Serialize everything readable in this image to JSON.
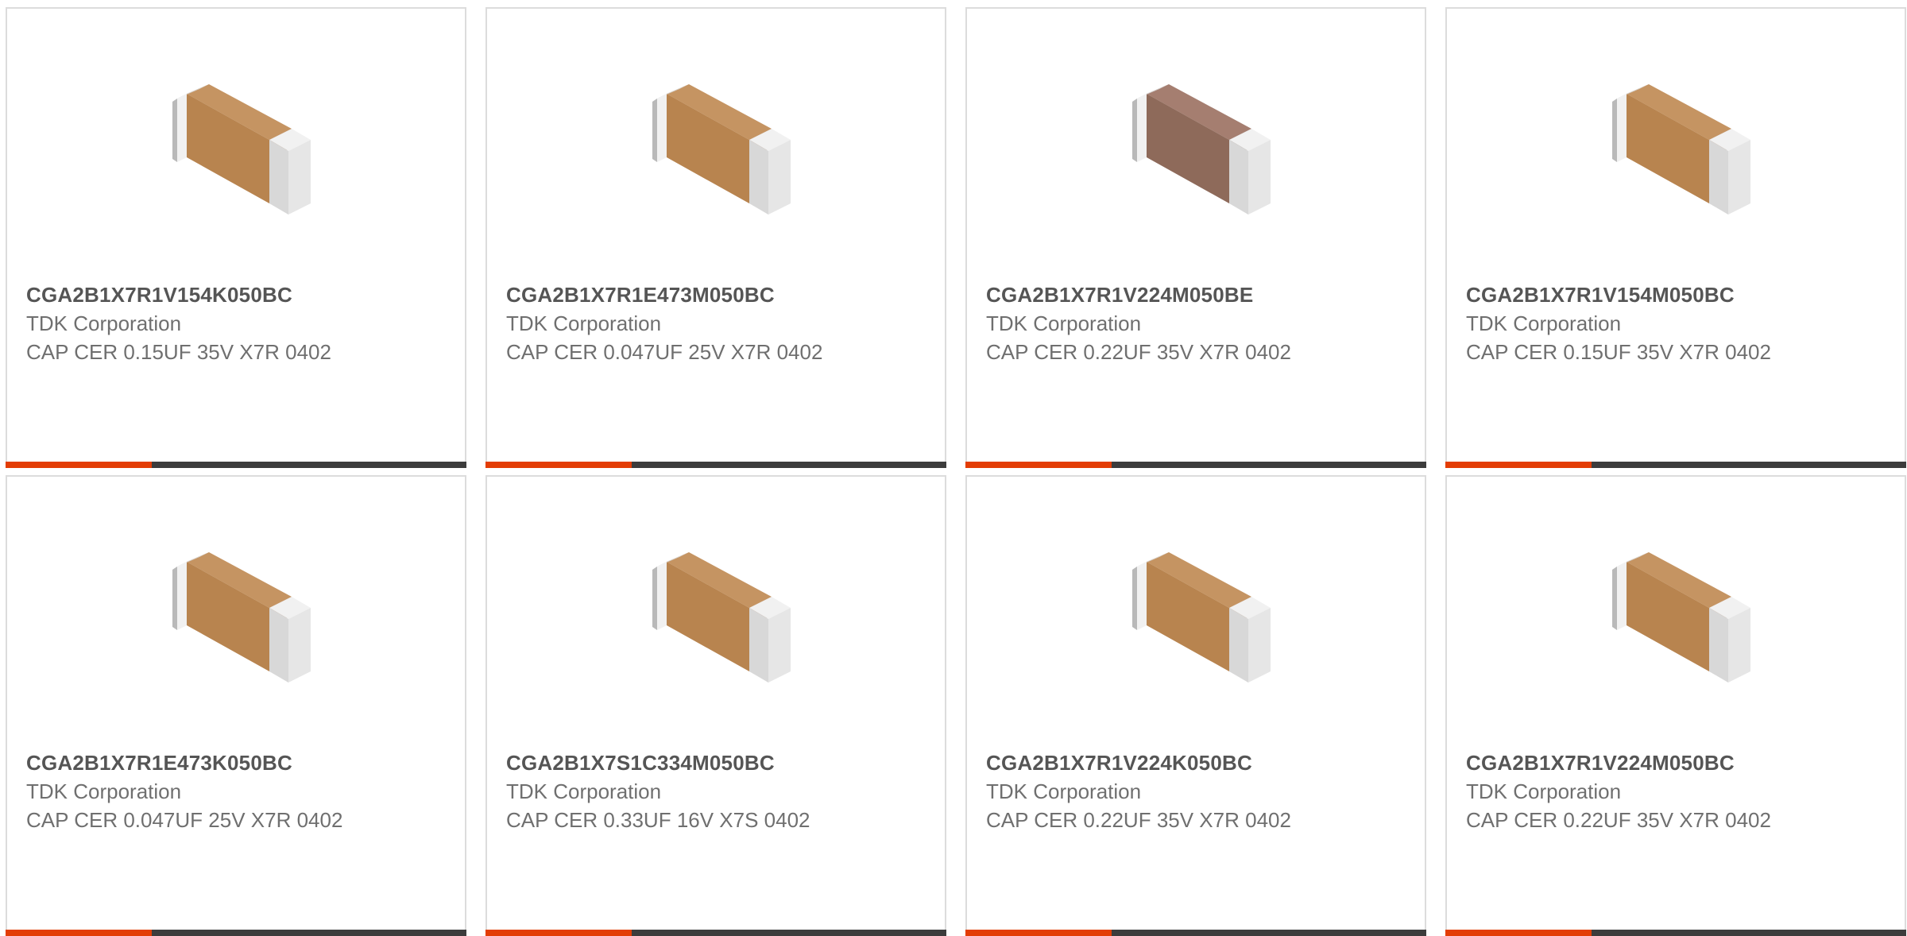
{
  "colors": {
    "accent_bar": "#e33d05",
    "dark_bar": "#3c3c3c",
    "body_light": "#c59462",
    "body_mid": "#b8844f",
    "body_dark": "#9f6e40",
    "body_brown_light": "#a57e70",
    "body_brown_mid": "#8e6a5a",
    "body_brown_dark": "#76574a",
    "cap_light": "#f1f1f1",
    "cap_mid": "#d8d8d8",
    "cap_dark": "#b9b9b9"
  },
  "products": [
    {
      "part_number": "CGA2B1X7R1V154K050BC",
      "manufacturer": "TDK Corporation",
      "description": "CAP CER 0.15UF 35V X7R 0402",
      "image_icon": "ceramic-capacitor-icon",
      "body_tone": "tan"
    },
    {
      "part_number": "CGA2B1X7R1E473M050BC",
      "manufacturer": "TDK Corporation",
      "description": "CAP CER 0.047UF 25V X7R 0402",
      "image_icon": "ceramic-capacitor-icon",
      "body_tone": "tan"
    },
    {
      "part_number": "CGA2B1X7R1V224M050BE",
      "manufacturer": "TDK Corporation",
      "description": "CAP CER 0.22UF 35V X7R 0402",
      "image_icon": "ceramic-capacitor-icon",
      "body_tone": "brown"
    },
    {
      "part_number": "CGA2B1X7R1V154M050BC",
      "manufacturer": "TDK Corporation",
      "description": "CAP CER 0.15UF 35V X7R 0402",
      "image_icon": "ceramic-capacitor-icon",
      "body_tone": "tan"
    },
    {
      "part_number": "CGA2B1X7R1E473K050BC",
      "manufacturer": "TDK Corporation",
      "description": "CAP CER 0.047UF 25V X7R 0402",
      "image_icon": "ceramic-capacitor-icon",
      "body_tone": "tan"
    },
    {
      "part_number": "CGA2B1X7S1C334M050BC",
      "manufacturer": "TDK Corporation",
      "description": "CAP CER 0.33UF 16V X7S 0402",
      "image_icon": "ceramic-capacitor-icon",
      "body_tone": "tan"
    },
    {
      "part_number": "CGA2B1X7R1V224K050BC",
      "manufacturer": "TDK Corporation",
      "description": "CAP CER 0.22UF 35V X7R 0402",
      "image_icon": "ceramic-capacitor-icon",
      "body_tone": "tan"
    },
    {
      "part_number": "CGA2B1X7R1V224M050BC",
      "manufacturer": "TDK Corporation",
      "description": "CAP CER 0.22UF 35V X7R 0402",
      "image_icon": "ceramic-capacitor-icon",
      "body_tone": "tan"
    }
  ]
}
